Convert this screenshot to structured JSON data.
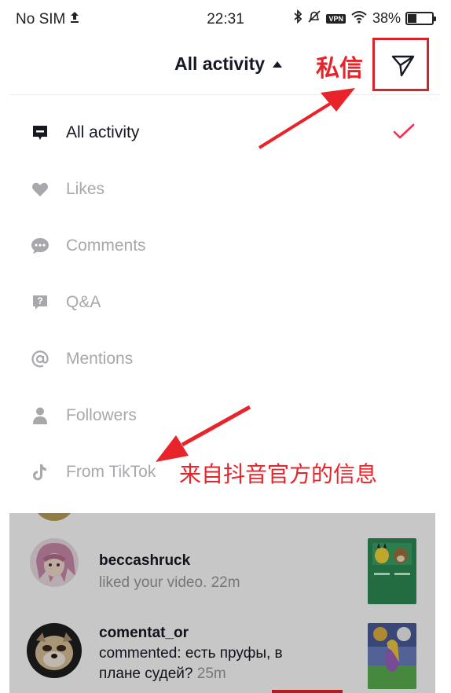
{
  "status_bar": {
    "carrier": "No SIM",
    "time": "22:31",
    "vpn": "VPN",
    "battery": "38%",
    "battery_level": 0.38
  },
  "header": {
    "title": "All activity"
  },
  "annotations": {
    "direct_message": "私信",
    "from_tiktok_note": "来自抖音官方的信息"
  },
  "filter_menu": {
    "items": [
      {
        "label": "All activity",
        "icon": "message-square-icon",
        "selected": true
      },
      {
        "label": "Likes",
        "icon": "heart-icon",
        "selected": false
      },
      {
        "label": "Comments",
        "icon": "comment-bubble-icon",
        "selected": false
      },
      {
        "label": "Q&A",
        "icon": "question-icon",
        "selected": false
      },
      {
        "label": "Mentions",
        "icon": "at-sign-icon",
        "selected": false
      },
      {
        "label": "Followers",
        "icon": "person-icon",
        "selected": false
      },
      {
        "label": "From TikTok",
        "icon": "tiktok-logo-icon",
        "selected": false
      }
    ]
  },
  "feed": [
    {
      "username": "beccashruck",
      "text": "liked your video.",
      "time": "22m"
    },
    {
      "username": "comentat_or",
      "text_line1": "commented: есть пруфы, в",
      "text_line2": "плане судей?",
      "time": "25m"
    }
  ],
  "colors": {
    "accent": "#fe2c55",
    "annotation_red": "#e8232a",
    "primary_text": "#161823",
    "muted_text": "#a8a8ac"
  }
}
